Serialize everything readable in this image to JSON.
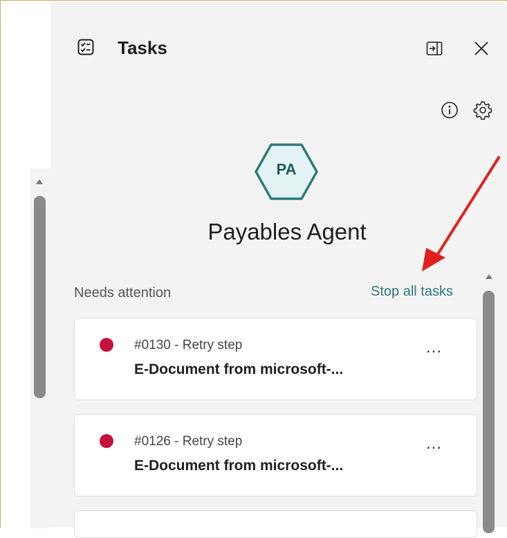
{
  "header": {
    "title": "Tasks"
  },
  "agent": {
    "initials": "PA",
    "name": "Payables Agent"
  },
  "section": {
    "label": "Needs attention",
    "stop_all_label": "Stop all tasks"
  },
  "tasks": [
    {
      "meta": "#0130 - Retry step",
      "title": "E-Document from microsoft-...",
      "more": "...",
      "status_color": "#c4123a"
    },
    {
      "meta": "#0126 - Retry step",
      "title": "E-Document from microsoft-...",
      "more": "...",
      "status_color": "#c4123a"
    }
  ],
  "colors": {
    "accent": "#2f7a7a",
    "avatar_fill": "#e3f3f3",
    "avatar_border": "#2f7a7a",
    "status_error": "#c4123a",
    "annotation_arrow": "#e02020"
  },
  "icons": {
    "header": "tasks-checklist-icon",
    "dock": "dock-panel-icon",
    "close": "close-icon",
    "info": "info-icon",
    "settings": "gear-icon"
  }
}
